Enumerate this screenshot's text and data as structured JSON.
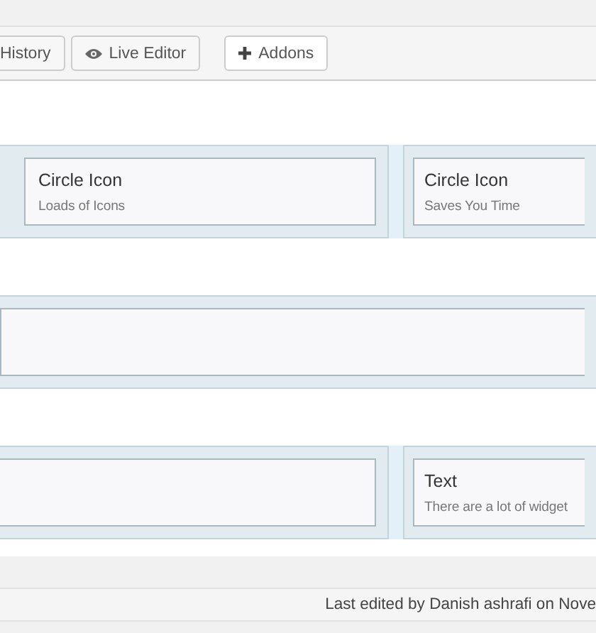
{
  "toolbar": {
    "buttons": [
      {
        "label": "History",
        "kind": "text"
      },
      {
        "label": "Live Editor",
        "kind": "eye"
      },
      {
        "label": "Addons",
        "kind": "plus"
      }
    ]
  },
  "rows": [
    {
      "cells": [
        {
          "title": "Circle Icon",
          "description": "Loads of Icons"
        },
        {
          "title": "Circle Icon",
          "description": "Saves You Time"
        }
      ]
    },
    {
      "cells": [
        {}
      ]
    },
    {
      "cells": [
        {},
        {
          "title": "Text",
          "description": "There are a lot of widget"
        }
      ]
    }
  ],
  "status_bar": {
    "text": "Last edited by Danish ashrafi on Nove"
  }
}
